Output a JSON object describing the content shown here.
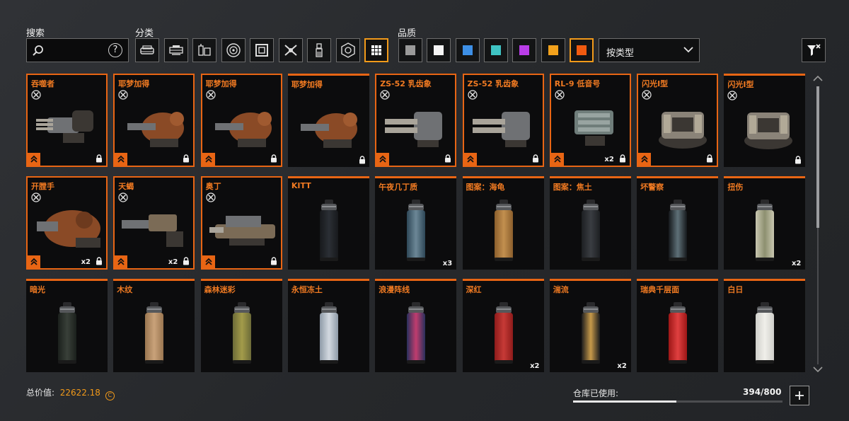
{
  "search": {
    "label": "搜索",
    "value": "",
    "placeholder": "",
    "help": "?"
  },
  "category": {
    "label": "分类",
    "icons": [
      "vehicle-icon",
      "cabin-icon",
      "parts-icon",
      "wheel-icon",
      "frame-icon",
      "weapon-icon",
      "paint-icon",
      "module-icon",
      "all-icon"
    ],
    "active": "all-icon"
  },
  "quality": {
    "label": "品质",
    "swatches": [
      "#9a9a9a",
      "#f4f4f4",
      "#3d8fe6",
      "#3fc4c4",
      "#b93de8",
      "#f2a11c",
      "#f05a10"
    ],
    "active_index": 6
  },
  "sort": {
    "value": "按类型"
  },
  "items": [
    {
      "name": "吞噬者",
      "kind": "gun",
      "weapon_icon": true,
      "rank": true,
      "count": "",
      "locked": true
    },
    {
      "name": "耶梦加得",
      "kind": "mech",
      "weapon_icon": true,
      "rank": true,
      "count": "",
      "locked": true
    },
    {
      "name": "耶梦加得",
      "kind": "mech",
      "weapon_icon": true,
      "rank": true,
      "count": "",
      "locked": true
    },
    {
      "name": "耶梦加得",
      "kind": "mech",
      "weapon_icon": false,
      "rank": false,
      "count": "",
      "locked": true
    },
    {
      "name": "ZS-52 乳齿象",
      "kind": "cannon",
      "weapon_icon": true,
      "rank": true,
      "count": "",
      "locked": true
    },
    {
      "name": "ZS-52 乳齿象",
      "kind": "cannon",
      "weapon_icon": true,
      "rank": true,
      "count": "",
      "locked": true
    },
    {
      "name": "RL-9 低音号",
      "kind": "rocket",
      "weapon_icon": true,
      "rank": true,
      "count": "x2",
      "locked": true
    },
    {
      "name": "闪光I型",
      "kind": "turret",
      "weapon_icon": true,
      "rank": true,
      "count": "",
      "locked": true
    },
    {
      "name": "闪光I型",
      "kind": "turret",
      "weapon_icon": true,
      "rank": false,
      "count": "",
      "locked": true
    },
    {
      "name": "开膛手",
      "kind": "ripper",
      "weapon_icon": true,
      "rank": true,
      "count": "x2",
      "locked": true
    },
    {
      "name": "天蝎",
      "kind": "rifle",
      "weapon_icon": true,
      "rank": true,
      "count": "x2",
      "locked": true
    },
    {
      "name": "奥丁",
      "kind": "odin",
      "weapon_icon": true,
      "rank": true,
      "count": "",
      "locked": true
    },
    {
      "name": "KITT",
      "kind": "paint",
      "colors": [
        "#17191c",
        "#2b2f35"
      ],
      "count": ""
    },
    {
      "name": "午夜几丁质",
      "kind": "paint",
      "colors": [
        "#2e4757",
        "#6c8796"
      ],
      "count": "x3"
    },
    {
      "name": "图案：海龟",
      "kind": "paint",
      "colors": [
        "#8b5e2c",
        "#c2904f"
      ],
      "count": ""
    },
    {
      "name": "图案：焦土",
      "kind": "paint",
      "colors": [
        "#1d1f22",
        "#3a3d42"
      ],
      "count": ""
    },
    {
      "name": "坏警察",
      "kind": "paint",
      "colors": [
        "#15181b",
        "#5e7078"
      ],
      "count": ""
    },
    {
      "name": "扭伤",
      "kind": "paint",
      "colors": [
        "#c9c7b0",
        "#8d9070"
      ],
      "count": "x2"
    },
    {
      "name": "暗光",
      "kind": "paint",
      "colors": [
        "#1b201c",
        "#394039"
      ],
      "count": ""
    },
    {
      "name": "木纹",
      "kind": "paint",
      "colors": [
        "#9a7650",
        "#c9a27a"
      ],
      "count": ""
    },
    {
      "name": "森林迷彩",
      "kind": "paint",
      "colors": [
        "#6b6a38",
        "#a39c4a"
      ],
      "count": ""
    },
    {
      "name": "永恒冻土",
      "kind": "paint",
      "colors": [
        "#8e9aa7",
        "#d3d9e0"
      ],
      "count": ""
    },
    {
      "name": "浪漫阵线",
      "kind": "paint",
      "colors": [
        "#28305c",
        "#c03d6e"
      ],
      "count": ""
    },
    {
      "name": "深红",
      "kind": "paint",
      "colors": [
        "#8e1b1b",
        "#c63a36"
      ],
      "count": "x2"
    },
    {
      "name": "湍流",
      "kind": "paint",
      "colors": [
        "#1b1b1d",
        "#c79a4a"
      ],
      "count": "x2"
    },
    {
      "name": "瑞典千层面",
      "kind": "paint",
      "colors": [
        "#9c1616",
        "#e04040"
      ],
      "count": ""
    },
    {
      "name": "白日",
      "kind": "paint",
      "colors": [
        "#cfcfca",
        "#f0efea"
      ],
      "count": ""
    }
  ],
  "footer": {
    "total_label": "总价值:",
    "total_value": "22622.18",
    "storage_label": "仓库已使用:",
    "storage_value": "394/800",
    "storage_used": 394,
    "storage_max": 800
  },
  "scroll": {
    "position": 0
  }
}
